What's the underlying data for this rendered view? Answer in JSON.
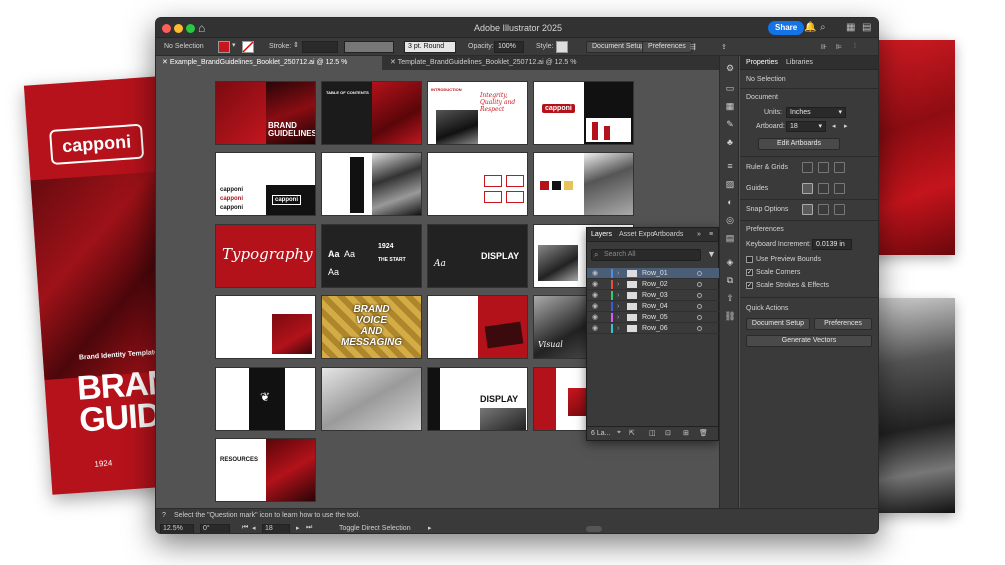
{
  "background": {
    "booklet_logo": "capponi",
    "booklet_subtitle": "Brand Identity Template",
    "booklet_title_line1": "BRAN",
    "booklet_title_line2": "GUID",
    "booklet_year": "1924"
  },
  "window": {
    "title": "Adobe Illustrator 2025",
    "share_label": "Share"
  },
  "control_bar": {
    "selection": "No Selection",
    "stroke_label": "Stroke:",
    "brush_value": "3 pt. Round",
    "opacity_label": "Opacity:",
    "opacity_value": "100%",
    "style_label": "Style:",
    "document_setup": "Document Setup",
    "preferences": "Preferences"
  },
  "tabs": [
    {
      "label": "Example_BrandGuidelines_Booklet_250712.ai @ 12.5 % (CMYK/Preview)"
    },
    {
      "label": "Template_BrandGuidelines_Booklet_250712.ai @ 12.5 % (CMYK/Preview)"
    }
  ],
  "artboards": {
    "brand_guidelines": "BRAND GUIDELINES",
    "table_of_contents": "TABLE OF CONTENTS",
    "introduction": "INTRODUCTION",
    "intro_script": "Integrity, Quality and Respect",
    "logo_text": "capponi",
    "typography": "Typography",
    "year_1924": "1924",
    "the_start": "THE START",
    "display": "DISPLAY",
    "voice_line1": "BRAND",
    "voice_line2": "VOICE",
    "voice_line3": "AND",
    "voice_line4": "MESSAGING",
    "visual": "Visual",
    "resources": "RESOURCES",
    "aa": "Aa"
  },
  "layers_panel": {
    "tabs": [
      "Layers",
      "Asset Expo",
      "Artboards"
    ],
    "search_placeholder": "Search All",
    "rows": [
      {
        "name": "Row_01",
        "color": "#4a90e2"
      },
      {
        "name": "Row_02",
        "color": "#e74c3c"
      },
      {
        "name": "Row_03",
        "color": "#2ecc71"
      },
      {
        "name": "Row_04",
        "color": "#3b5bdb"
      },
      {
        "name": "Row_05",
        "color": "#e056fd"
      },
      {
        "name": "Row_06",
        "color": "#3fc1c9"
      }
    ],
    "footer_count": "6 La..."
  },
  "properties": {
    "tabs": [
      "Properties",
      "Libraries"
    ],
    "no_selection": "No Selection",
    "document_heading": "Document",
    "units_label": "Units:",
    "units_value": "Inches",
    "artboard_label": "Artboard:",
    "artboard_value": "18",
    "edit_artboards": "Edit Artboards",
    "ruler_grids": "Ruler & Grids",
    "guides": "Guides",
    "snap_options": "Snap Options",
    "preferences_heading": "Preferences",
    "keyboard_increment_label": "Keyboard Increment:",
    "keyboard_increment_value": "0.0139 in",
    "use_preview_bounds": "Use Preview Bounds",
    "scale_corners": "Scale Corners",
    "scale_strokes": "Scale Strokes & Effects",
    "quick_actions": "Quick Actions",
    "qa_document_setup": "Document Setup",
    "qa_preferences": "Preferences",
    "generate_vectors": "Generate Vectors"
  },
  "status": {
    "hint": "Select the \"Question mark\" icon to learn how to use the tool.",
    "zoom": "12.5%",
    "rotation": "0°",
    "artboard_nav": "18",
    "tool_readout": "Toggle Direct Selection"
  }
}
